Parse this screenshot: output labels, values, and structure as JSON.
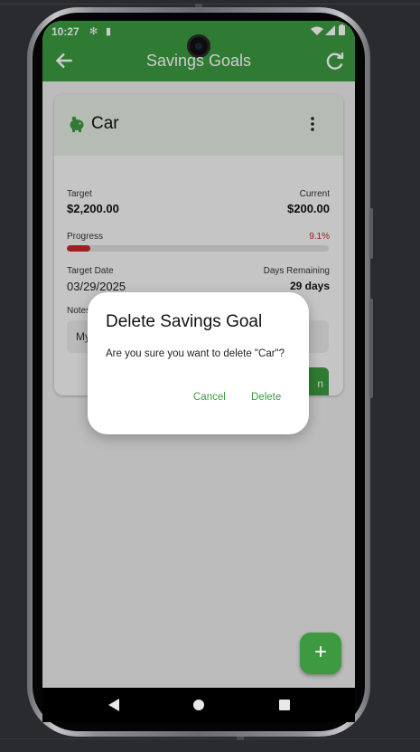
{
  "status_bar": {
    "time": "10:27"
  },
  "app_bar": {
    "title": "Savings Goals",
    "back_icon": "arrow-left-icon",
    "refresh_icon": "refresh-icon"
  },
  "goal_card": {
    "name": "Car",
    "icon": "piggy-bank-icon",
    "target_label": "Target",
    "target_value": "$2,200.00",
    "current_label": "Current",
    "current_value": "$200.00",
    "progress_label": "Progress",
    "progress_text": "9.1%",
    "progress_fraction": 0.091,
    "target_date_label": "Target Date",
    "target_date_value": "03/29/2025",
    "days_remaining_label": "Days Remaining",
    "days_remaining_value": "29 days",
    "notes_label": "Notes",
    "notes_value": "My",
    "action_button_partial": "n"
  },
  "dialog": {
    "title": "Delete Savings Goal",
    "message": "Are you sure you want to delete \"Car\"?",
    "cancel_label": "Cancel",
    "delete_label": "Delete"
  },
  "fab": {
    "icon": "plus-icon",
    "label": "+"
  },
  "colors": {
    "primary": "#3d9a40",
    "progress": "#c62828"
  }
}
